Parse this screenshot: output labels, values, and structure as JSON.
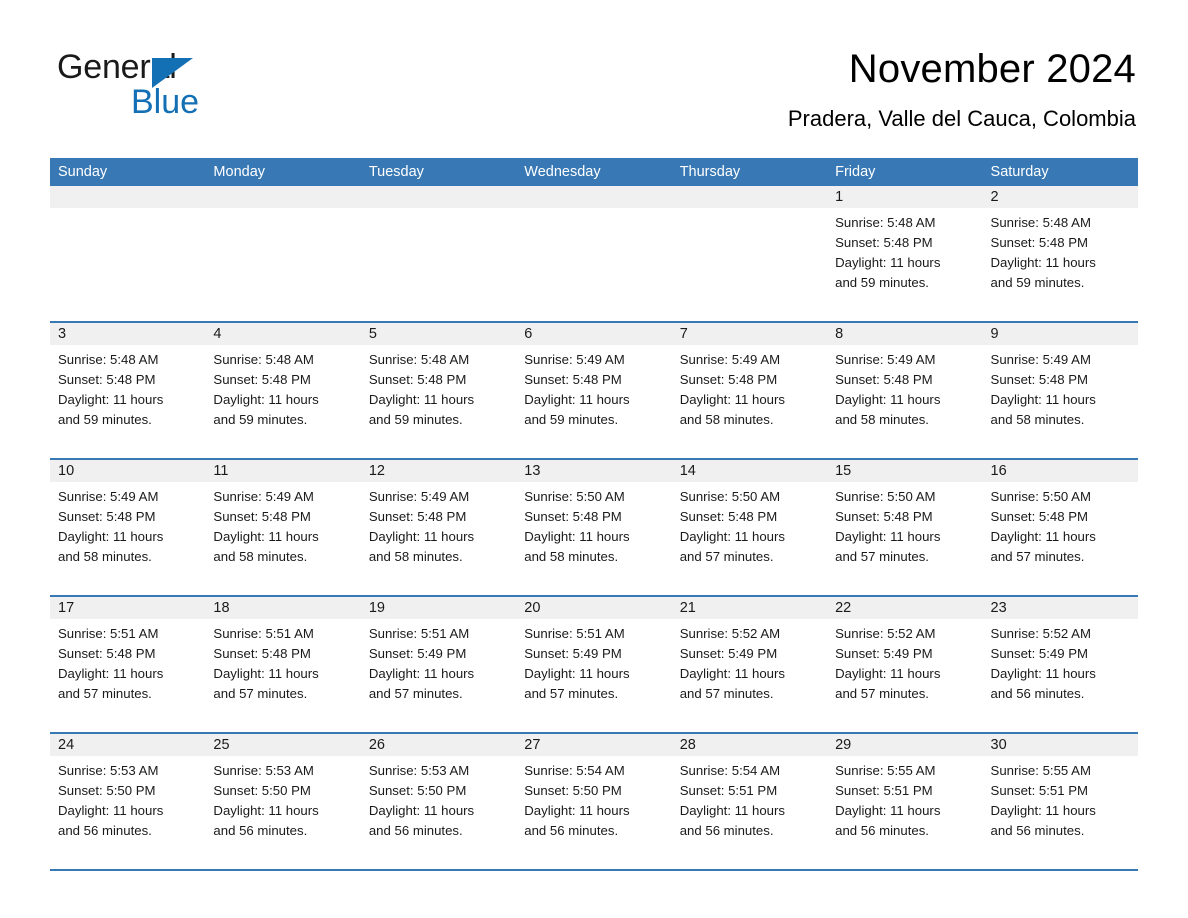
{
  "brand": {
    "name_part1": "General",
    "name_part2": "Blue",
    "accent_color": "#1470b5",
    "logo_icon": "triangle-icon"
  },
  "header": {
    "title": "November 2024",
    "location": "Pradera, Valle del Cauca, Colombia"
  },
  "calendar": {
    "header_background": "#3878b4",
    "day_strip_background": "#f0f0f0",
    "weekdays": [
      "Sunday",
      "Monday",
      "Tuesday",
      "Wednesday",
      "Thursday",
      "Friday",
      "Saturday"
    ],
    "weeks": [
      [
        {
          "day": "",
          "sunrise": "",
          "sunset": "",
          "daylight_line1": "",
          "daylight_line2": "",
          "empty": true
        },
        {
          "day": "",
          "sunrise": "",
          "sunset": "",
          "daylight_line1": "",
          "daylight_line2": "",
          "empty": true
        },
        {
          "day": "",
          "sunrise": "",
          "sunset": "",
          "daylight_line1": "",
          "daylight_line2": "",
          "empty": true
        },
        {
          "day": "",
          "sunrise": "",
          "sunset": "",
          "daylight_line1": "",
          "daylight_line2": "",
          "empty": true
        },
        {
          "day": "",
          "sunrise": "",
          "sunset": "",
          "daylight_line1": "",
          "daylight_line2": "",
          "empty": true
        },
        {
          "day": "1",
          "sunrise": "Sunrise: 5:48 AM",
          "sunset": "Sunset: 5:48 PM",
          "daylight_line1": "Daylight: 11 hours",
          "daylight_line2": "and 59 minutes."
        },
        {
          "day": "2",
          "sunrise": "Sunrise: 5:48 AM",
          "sunset": "Sunset: 5:48 PM",
          "daylight_line1": "Daylight: 11 hours",
          "daylight_line2": "and 59 minutes."
        }
      ],
      [
        {
          "day": "3",
          "sunrise": "Sunrise: 5:48 AM",
          "sunset": "Sunset: 5:48 PM",
          "daylight_line1": "Daylight: 11 hours",
          "daylight_line2": "and 59 minutes."
        },
        {
          "day": "4",
          "sunrise": "Sunrise: 5:48 AM",
          "sunset": "Sunset: 5:48 PM",
          "daylight_line1": "Daylight: 11 hours",
          "daylight_line2": "and 59 minutes."
        },
        {
          "day": "5",
          "sunrise": "Sunrise: 5:48 AM",
          "sunset": "Sunset: 5:48 PM",
          "daylight_line1": "Daylight: 11 hours",
          "daylight_line2": "and 59 minutes."
        },
        {
          "day": "6",
          "sunrise": "Sunrise: 5:49 AM",
          "sunset": "Sunset: 5:48 PM",
          "daylight_line1": "Daylight: 11 hours",
          "daylight_line2": "and 59 minutes."
        },
        {
          "day": "7",
          "sunrise": "Sunrise: 5:49 AM",
          "sunset": "Sunset: 5:48 PM",
          "daylight_line1": "Daylight: 11 hours",
          "daylight_line2": "and 58 minutes."
        },
        {
          "day": "8",
          "sunrise": "Sunrise: 5:49 AM",
          "sunset": "Sunset: 5:48 PM",
          "daylight_line1": "Daylight: 11 hours",
          "daylight_line2": "and 58 minutes."
        },
        {
          "day": "9",
          "sunrise": "Sunrise: 5:49 AM",
          "sunset": "Sunset: 5:48 PM",
          "daylight_line1": "Daylight: 11 hours",
          "daylight_line2": "and 58 minutes."
        }
      ],
      [
        {
          "day": "10",
          "sunrise": "Sunrise: 5:49 AM",
          "sunset": "Sunset: 5:48 PM",
          "daylight_line1": "Daylight: 11 hours",
          "daylight_line2": "and 58 minutes."
        },
        {
          "day": "11",
          "sunrise": "Sunrise: 5:49 AM",
          "sunset": "Sunset: 5:48 PM",
          "daylight_line1": "Daylight: 11 hours",
          "daylight_line2": "and 58 minutes."
        },
        {
          "day": "12",
          "sunrise": "Sunrise: 5:49 AM",
          "sunset": "Sunset: 5:48 PM",
          "daylight_line1": "Daylight: 11 hours",
          "daylight_line2": "and 58 minutes."
        },
        {
          "day": "13",
          "sunrise": "Sunrise: 5:50 AM",
          "sunset": "Sunset: 5:48 PM",
          "daylight_line1": "Daylight: 11 hours",
          "daylight_line2": "and 58 minutes."
        },
        {
          "day": "14",
          "sunrise": "Sunrise: 5:50 AM",
          "sunset": "Sunset: 5:48 PM",
          "daylight_line1": "Daylight: 11 hours",
          "daylight_line2": "and 57 minutes."
        },
        {
          "day": "15",
          "sunrise": "Sunrise: 5:50 AM",
          "sunset": "Sunset: 5:48 PM",
          "daylight_line1": "Daylight: 11 hours",
          "daylight_line2": "and 57 minutes."
        },
        {
          "day": "16",
          "sunrise": "Sunrise: 5:50 AM",
          "sunset": "Sunset: 5:48 PM",
          "daylight_line1": "Daylight: 11 hours",
          "daylight_line2": "and 57 minutes."
        }
      ],
      [
        {
          "day": "17",
          "sunrise": "Sunrise: 5:51 AM",
          "sunset": "Sunset: 5:48 PM",
          "daylight_line1": "Daylight: 11 hours",
          "daylight_line2": "and 57 minutes."
        },
        {
          "day": "18",
          "sunrise": "Sunrise: 5:51 AM",
          "sunset": "Sunset: 5:48 PM",
          "daylight_line1": "Daylight: 11 hours",
          "daylight_line2": "and 57 minutes."
        },
        {
          "day": "19",
          "sunrise": "Sunrise: 5:51 AM",
          "sunset": "Sunset: 5:49 PM",
          "daylight_line1": "Daylight: 11 hours",
          "daylight_line2": "and 57 minutes."
        },
        {
          "day": "20",
          "sunrise": "Sunrise: 5:51 AM",
          "sunset": "Sunset: 5:49 PM",
          "daylight_line1": "Daylight: 11 hours",
          "daylight_line2": "and 57 minutes."
        },
        {
          "day": "21",
          "sunrise": "Sunrise: 5:52 AM",
          "sunset": "Sunset: 5:49 PM",
          "daylight_line1": "Daylight: 11 hours",
          "daylight_line2": "and 57 minutes."
        },
        {
          "day": "22",
          "sunrise": "Sunrise: 5:52 AM",
          "sunset": "Sunset: 5:49 PM",
          "daylight_line1": "Daylight: 11 hours",
          "daylight_line2": "and 57 minutes."
        },
        {
          "day": "23",
          "sunrise": "Sunrise: 5:52 AM",
          "sunset": "Sunset: 5:49 PM",
          "daylight_line1": "Daylight: 11 hours",
          "daylight_line2": "and 56 minutes."
        }
      ],
      [
        {
          "day": "24",
          "sunrise": "Sunrise: 5:53 AM",
          "sunset": "Sunset: 5:50 PM",
          "daylight_line1": "Daylight: 11 hours",
          "daylight_line2": "and 56 minutes."
        },
        {
          "day": "25",
          "sunrise": "Sunrise: 5:53 AM",
          "sunset": "Sunset: 5:50 PM",
          "daylight_line1": "Daylight: 11 hours",
          "daylight_line2": "and 56 minutes."
        },
        {
          "day": "26",
          "sunrise": "Sunrise: 5:53 AM",
          "sunset": "Sunset: 5:50 PM",
          "daylight_line1": "Daylight: 11 hours",
          "daylight_line2": "and 56 minutes."
        },
        {
          "day": "27",
          "sunrise": "Sunrise: 5:54 AM",
          "sunset": "Sunset: 5:50 PM",
          "daylight_line1": "Daylight: 11 hours",
          "daylight_line2": "and 56 minutes."
        },
        {
          "day": "28",
          "sunrise": "Sunrise: 5:54 AM",
          "sunset": "Sunset: 5:51 PM",
          "daylight_line1": "Daylight: 11 hours",
          "daylight_line2": "and 56 minutes."
        },
        {
          "day": "29",
          "sunrise": "Sunrise: 5:55 AM",
          "sunset": "Sunset: 5:51 PM",
          "daylight_line1": "Daylight: 11 hours",
          "daylight_line2": "and 56 minutes."
        },
        {
          "day": "30",
          "sunrise": "Sunrise: 5:55 AM",
          "sunset": "Sunset: 5:51 PM",
          "daylight_line1": "Daylight: 11 hours",
          "daylight_line2": "and 56 minutes."
        }
      ]
    ]
  }
}
